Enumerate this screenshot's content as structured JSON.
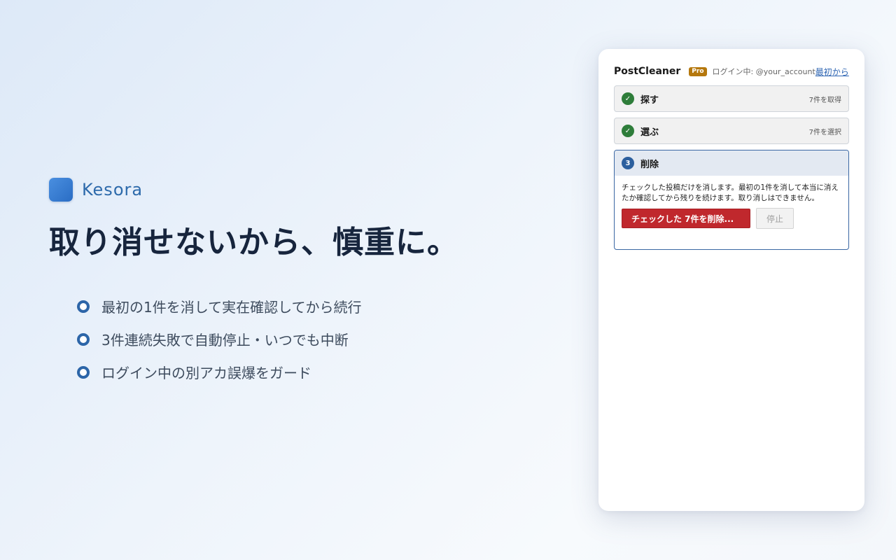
{
  "hero": {
    "brand": "Kesora",
    "headline": "取り消せないから、慎重に。",
    "features": [
      "最初の1件を消して実在確認してから続行",
      "3件連続失敗で自動停止・いつでも中断",
      "ログイン中の別アカ誤爆をガード"
    ]
  },
  "panel": {
    "app_name": "PostCleaner",
    "badge": "Pro",
    "login_status": "ログイン中: @your_account",
    "restart_link": "最初から",
    "steps": [
      {
        "icon": "check-icon",
        "icon_text": "✓",
        "title": "探す",
        "meta": "7件を取得",
        "status": "done"
      },
      {
        "icon": "check-icon",
        "icon_text": "✓",
        "title": "選ぶ",
        "meta": "7件を選択",
        "status": "done"
      },
      {
        "icon": "step-number",
        "icon_text": "3",
        "title": "削除",
        "status": "active",
        "description": "チェックした投稿だけを消します。最初の1件を消して本当に消えたか確認してから残りを続けます。取り消しはできません。",
        "delete_button": "チェックした 7件を削除...",
        "stop_button": "停止"
      }
    ]
  },
  "colors": {
    "brand": "#2d6aab",
    "headline": "#17253d",
    "done": "#2e7d3a",
    "active": "#2c5f9e",
    "danger": "#c0282d",
    "badge": "#b5780d"
  }
}
